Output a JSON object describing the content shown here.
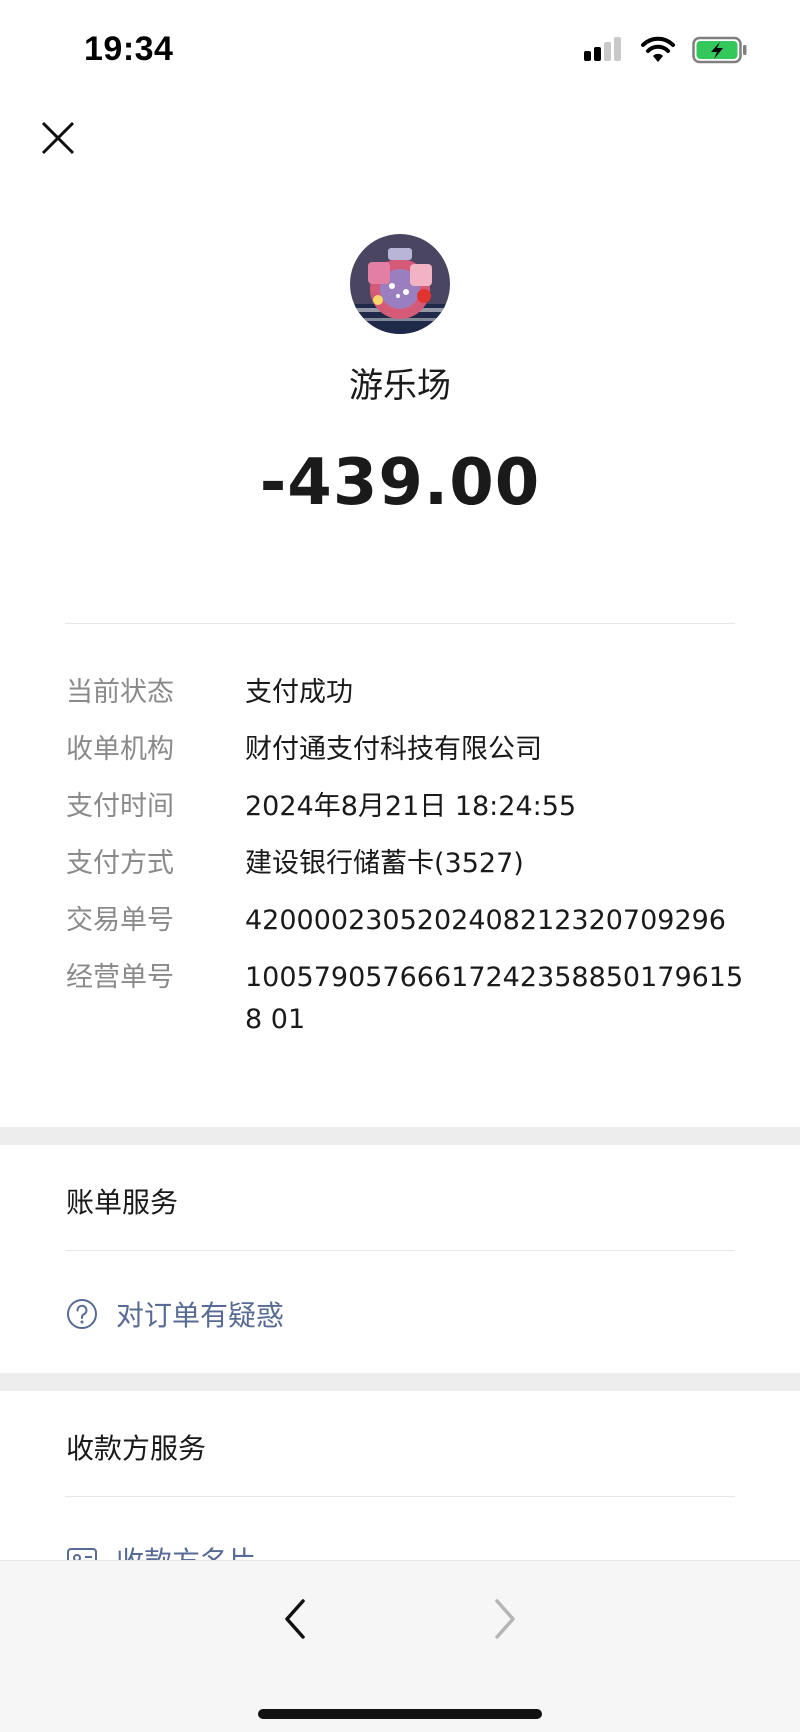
{
  "status_bar": {
    "time": "19:34"
  },
  "merchant": {
    "name": "游乐场"
  },
  "amount": "-439.00",
  "details": [
    {
      "label": "当前状态",
      "value": "支付成功"
    },
    {
      "label": "收单机构",
      "value": "财付通支付科技有限公司"
    },
    {
      "label": "支付时间",
      "value": "2024年8月21日 18:24:55"
    },
    {
      "label": "支付方式",
      "value": "建设银行储蓄卡(3527)"
    },
    {
      "label": "交易单号",
      "value": "4200002305202408212320709296"
    },
    {
      "label": "经营单号",
      "value": "100579057666172423588501796158 01"
    }
  ],
  "bill_service": {
    "title": "账单服务",
    "link": "对订单有疑惑"
  },
  "payee_service": {
    "title": "收款方服务",
    "link": "收款方名片"
  },
  "colors": {
    "link": "#576b95",
    "label": "#8a8a8a",
    "battery": "#34c759"
  }
}
